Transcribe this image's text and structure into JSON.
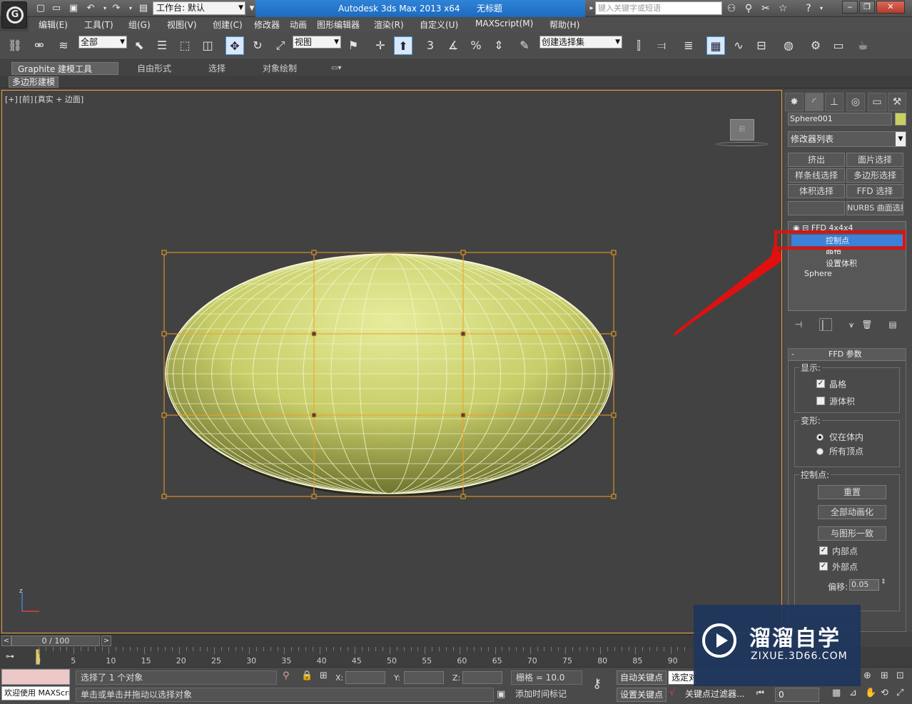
{
  "titlebar": {
    "workspace_label": "工作台: 默认",
    "app_title": "Autodesk 3ds Max  2013 x64",
    "doc_title": "无标题",
    "search_placeholder": "键入关键字或短语",
    "icons": [
      "binoculars-icon",
      "wrench-icon",
      "tools-icon",
      "star-icon",
      "help-icon"
    ]
  },
  "menu": [
    "编辑(E)",
    "工具(T)",
    "组(G)",
    "视图(V)",
    "创建(C)",
    "修改器",
    "动画",
    "图形编辑器",
    "渲染(R)",
    "自定义(U)",
    "MAXScript(M)",
    "帮助(H)"
  ],
  "toolbar": {
    "selection_filter": "全部",
    "ref_coord": "视图",
    "named_selection": "创建选择集",
    "snap_labels": [
      "3",
      "%"
    ]
  },
  "ribbon": {
    "tabs": [
      "Graphite 建模工具",
      "自由形式",
      "选择",
      "对象绘制"
    ],
    "sub_label": "多边形建模"
  },
  "viewport": {
    "label_parts": [
      "[+]",
      "[前]",
      "[真实 + 边面]"
    ],
    "viewcube_face": "前",
    "axis_label": "z"
  },
  "command_panel": {
    "object_name": "Sphere001",
    "object_color": "#c8d060",
    "modifier_list": "修改器列表",
    "mod_buttons": [
      "挤出",
      "面片选择",
      "样条线选择",
      "多边形选择",
      "体积选择",
      "FFD 选择",
      "",
      "NURBS 曲面选择"
    ],
    "stack": {
      "ffd": "FFD 4x4x4",
      "sub_items": [
        "控制点",
        "晶格",
        "设置体积"
      ],
      "base": "Sphere"
    },
    "rollout_title": "FFD 参数",
    "display": {
      "title": "显示:",
      "lattice": "晶格",
      "lattice_checked": true,
      "source_volume": "源体积",
      "source_checked": false
    },
    "deform": {
      "title": "变形:",
      "inside": "仅在体内",
      "all": "所有顶点",
      "selected": "inside"
    },
    "control_points": {
      "title": "控制点:",
      "reset": "重置",
      "animate_all": "全部动画化",
      "conform": "与图形一致",
      "inside_points": "内部点",
      "inside_checked": true,
      "outside_points": "外部点",
      "outside_checked": true,
      "offset_label": "偏移:",
      "offset_value": "0.05"
    }
  },
  "timeline": {
    "frame_display": "0 / 100",
    "ticks": [
      "0",
      "5",
      "10",
      "15",
      "20",
      "25",
      "30",
      "35",
      "40",
      "45",
      "50",
      "55",
      "60",
      "65",
      "70",
      "75",
      "80",
      "85",
      "90"
    ]
  },
  "status": {
    "welcome": "欢迎使用 MAXScript。",
    "selected": "选择了 1 个对象",
    "prompt": "单击或单击并拖动以选择对象",
    "x_label": "X:",
    "y_label": "Y:",
    "z_label": "Z:",
    "grid": "栅格 = 10.0",
    "add_time_tag": "添加时间标记",
    "auto_key": "自动关键点",
    "set_key": "设置关键点",
    "selected_combo": "选定对",
    "key_filter": "关键点过滤器...",
    "frame": "0"
  },
  "watermark": {
    "name": "溜溜自学",
    "url": "ZIXUE.3D66.COM"
  },
  "colors": {
    "accent": "#2f84d8",
    "highlight": "#e01010",
    "lattice": "#f0a020",
    "mesh": "#c9cc6a"
  }
}
